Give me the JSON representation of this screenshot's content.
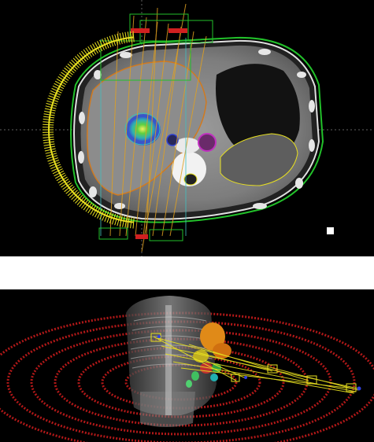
{
  "views": {
    "axial_ct": {
      "label": ""
    },
    "render_3d": {
      "label": ""
    }
  },
  "colors": {
    "background": "#000000",
    "separator": "#ffffff",
    "body_contour": "#22c02a",
    "arc_markers": "#e8e020",
    "beam_lines": "#e0a020",
    "liver_contour": "#d07a20",
    "target_dose": "#6ad04a",
    "vessel_magenta": "#c030c0",
    "vessel_blue": "#3040d0",
    "arc_3d": "#b01818"
  },
  "icons": [
    "crosshair-icon",
    "marker-square-icon"
  ]
}
